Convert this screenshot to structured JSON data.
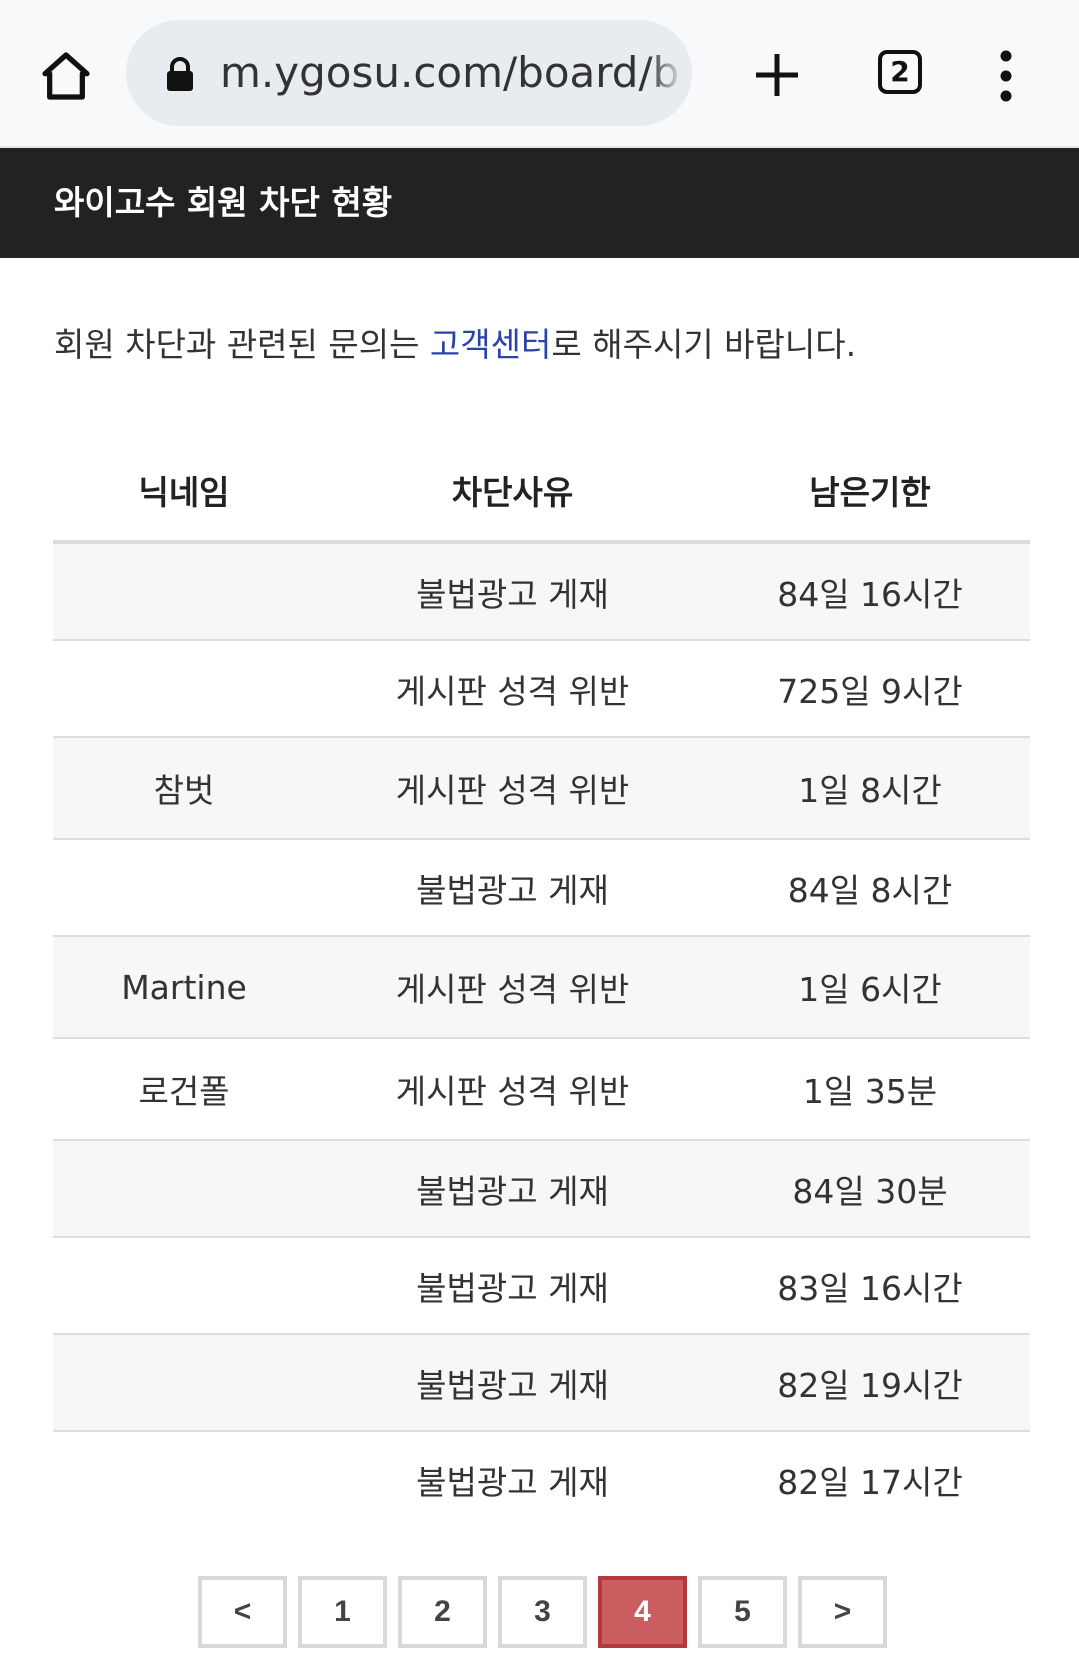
{
  "browser": {
    "url": "m.ygosu.com/board/b",
    "tab_count": "2",
    "icons": [
      "home-icon",
      "lock-icon",
      "plus-icon",
      "tabs-icon",
      "more-vert-icon"
    ]
  },
  "header": {
    "title": "와이고수 회원 차단 현황"
  },
  "notice": {
    "before": "회원 차단과 관련된 문의는 ",
    "link": "고객센터",
    "after": "로 해주시기 바랍니다."
  },
  "table": {
    "columns": [
      "닉네임",
      "차단사유",
      "남은기한"
    ],
    "rows": [
      {
        "nickname": "",
        "reason": "불법광고 게재",
        "remaining": "84일 16시간"
      },
      {
        "nickname": "",
        "reason": "게시판 성격 위반",
        "remaining": "725일 9시간"
      },
      {
        "nickname": "참벗",
        "reason": "게시판 성격 위반",
        "remaining": "1일 8시간"
      },
      {
        "nickname": "",
        "reason": "불법광고 게재",
        "remaining": "84일 8시간"
      },
      {
        "nickname": "Martine",
        "reason": "게시판 성격 위반",
        "remaining": "1일 6시간"
      },
      {
        "nickname": "로건폴",
        "reason": "게시판 성격 위반",
        "remaining": "1일 35분"
      },
      {
        "nickname": "",
        "reason": "불법광고 게재",
        "remaining": "84일 30분"
      },
      {
        "nickname": "",
        "reason": "불법광고 게재",
        "remaining": "83일 16시간"
      },
      {
        "nickname": "",
        "reason": "불법광고 게재",
        "remaining": "82일 19시간"
      },
      {
        "nickname": "",
        "reason": "불법광고 게재",
        "remaining": "82일 17시간"
      }
    ]
  },
  "pagination": {
    "prev": "<",
    "pages": [
      "1",
      "2",
      "3",
      "4",
      "5"
    ],
    "current": "4",
    "next": ">"
  },
  "colors": {
    "header_bg": "#222222",
    "link": "#2b43a8",
    "active_page": "#c95d5f"
  }
}
